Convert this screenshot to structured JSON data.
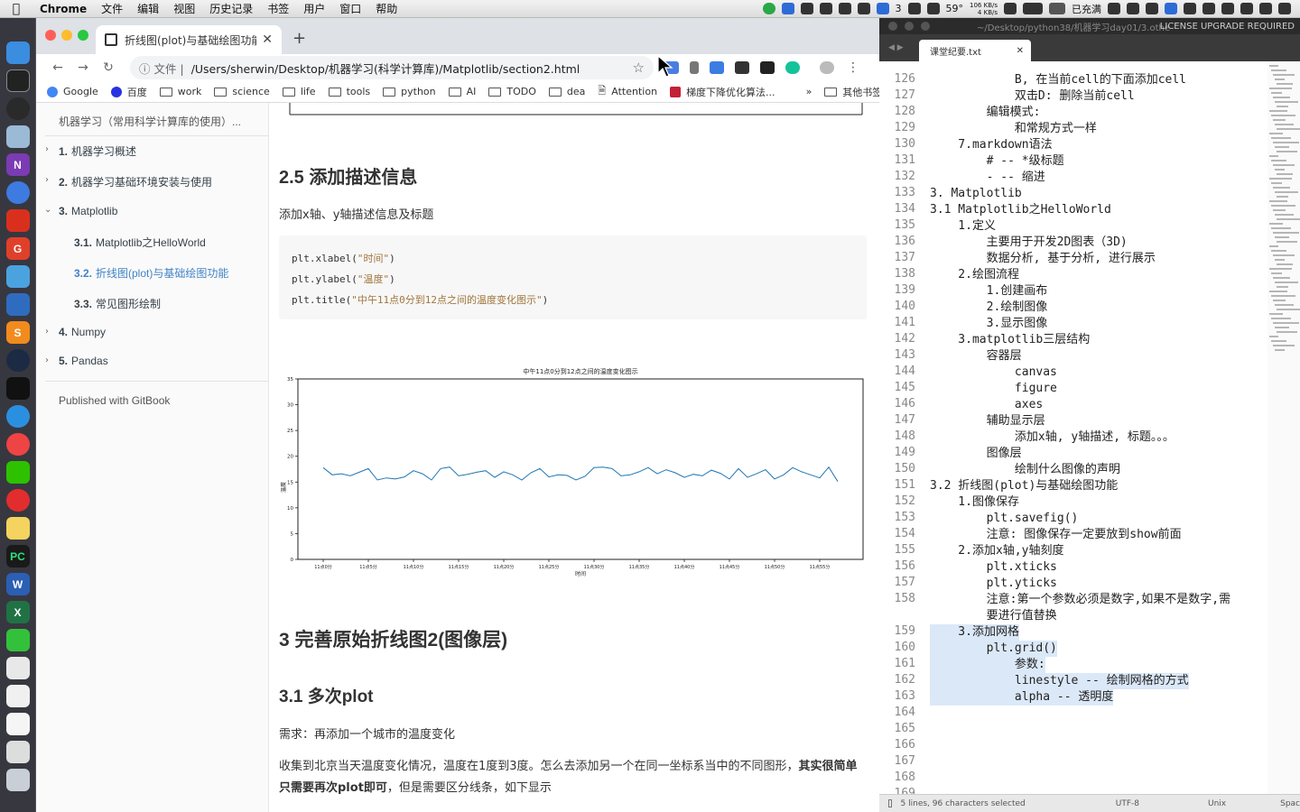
{
  "menubar": {
    "app": "Chrome",
    "items": [
      "文件",
      "编辑",
      "视图",
      "历史记录",
      "书签",
      "用户",
      "窗口",
      "帮助"
    ],
    "tray_count": "3",
    "temperature": "59°",
    "net_up": "106 KB/s",
    "net_down": "4 KB/s",
    "battery": "已充满"
  },
  "chrome": {
    "tab_title": "折线图(plot)与基础绘图功能 | 机",
    "address_info": "文件",
    "url": "/Users/sherwin/Desktop/机器学习(科学计算库)/Matplotlib/section2.html",
    "bookmarks": [
      "Google",
      "百度",
      "work",
      "science",
      "life",
      "tools",
      "python",
      "AI",
      "TODO",
      "dea",
      "Attention",
      "梯度下降优化算法..."
    ],
    "bookmarks_more": "»",
    "other_bookmarks": "其他书签"
  },
  "toc": {
    "title": "机器学习（常用科学计算库的使用）...",
    "items": [
      {
        "num": "1.",
        "label": "机器学习概述"
      },
      {
        "num": "2.",
        "label": "机器学习基础环境安装与使用"
      },
      {
        "num": "3.",
        "label": "Matplotlib"
      },
      {
        "num": "3.1.",
        "label": "Matplotlib之HelloWorld"
      },
      {
        "num": "3.2.",
        "label": "折线图(plot)与基础绘图功能"
      },
      {
        "num": "3.3.",
        "label": "常见图形绘制"
      },
      {
        "num": "4.",
        "label": "Numpy"
      },
      {
        "num": "5.",
        "label": "Pandas"
      }
    ],
    "published": "Published with GitBook"
  },
  "content": {
    "h_25": "2.5 添加描述信息",
    "p_25": "添加x轴、y轴描述信息及标题",
    "code": [
      {
        "pre": "plt.xlabel(",
        "str": "\"时间\"",
        "post": ")"
      },
      {
        "pre": "plt.ylabel(",
        "str": "\"温度\"",
        "post": ")"
      },
      {
        "pre": "plt.title(",
        "str": "\"中午11点0分到12点之间的温度变化图示\"",
        "post": ")"
      }
    ],
    "h_3": "3 完善原始折线图2(图像层)",
    "h_31": "3.1 多次plot",
    "p_need": "需求：再添加一个城市的温度变化",
    "p_desc_1": "收集到北京当天温度变化情况，温度在1度到3度。怎么去添加另一个在同一坐标系当中的不同图形，",
    "p_desc_bold": "其实很简单只需要再次plot即可",
    "p_desc_2": "，但是需要区分线条，如下显示"
  },
  "chart_data": {
    "type": "line",
    "title": "中午11点0分到12点之间的温度变化图示",
    "xlabel": "时间",
    "ylabel": "温度",
    "ylim": [
      0,
      35
    ],
    "yticks": [
      0,
      5,
      10,
      15,
      20,
      25,
      30,
      35
    ],
    "xticks": [
      "11点0分",
      "11点5分",
      "11点10分",
      "11点15分",
      "11点20分",
      "11点25分",
      "11点30分",
      "11点35分",
      "11点40分",
      "11点45分",
      "11点50分",
      "11点55分"
    ],
    "color": "#1f77b4",
    "series": [
      {
        "values": [
          17.8,
          16.4,
          16.6,
          16.2,
          16.9,
          17.6,
          15.4,
          15.8,
          15.6,
          16.0,
          17.2,
          16.6,
          15.4,
          17.6,
          17.9,
          16.2,
          16.5,
          16.9,
          17.2,
          15.9,
          17.0,
          16.4,
          15.4,
          16.8,
          17.6,
          16.0,
          16.4,
          16.3,
          15.4,
          16.1,
          17.8,
          17.9,
          17.6,
          16.2,
          16.4,
          17.0,
          17.8,
          16.6,
          17.4,
          16.8,
          15.9,
          16.5,
          16.2,
          17.3,
          16.7,
          15.6,
          17.6,
          15.9,
          16.6,
          17.4,
          15.6,
          16.4,
          17.8,
          17.0,
          16.4,
          15.8,
          17.9,
          15.1
        ]
      }
    ]
  },
  "sublime": {
    "title_path": "~/Desktop/python38/机器学习day01/3.othe",
    "license": "LICENSE UPGRADE REQUIRED",
    "tab": "课堂纪要.txt",
    "status_sel": "5 lines, 96 characters selected",
    "status_enc": "UTF-8",
    "status_eol": "Unix",
    "status_ind": "Spac",
    "lines": [
      {
        "n": "126",
        "t": "            B, 在当前cell的下面添加cell"
      },
      {
        "n": "127",
        "t": "            双击D: 删除当前cell"
      },
      {
        "n": "128",
        "t": "        编辑模式:"
      },
      {
        "n": "129",
        "t": "            和常规方式一样"
      },
      {
        "n": "130",
        "t": "    7.markdown语法"
      },
      {
        "n": "131",
        "t": "        # -- *级标题"
      },
      {
        "n": "132",
        "t": "        - -- 缩进"
      },
      {
        "n": "133",
        "t": "3. Matplotlib"
      },
      {
        "n": "134",
        "t": "3.1 Matplotlib之HelloWorld"
      },
      {
        "n": "135",
        "t": "    1.定义"
      },
      {
        "n": "136",
        "t": "        主要用于开发2D图表（3D)"
      },
      {
        "n": "137",
        "t": "        数据分析, 基于分析, 进行展示"
      },
      {
        "n": "138",
        "t": "    2.绘图流程"
      },
      {
        "n": "139",
        "t": "        1.创建画布"
      },
      {
        "n": "140",
        "t": "        2.绘制图像"
      },
      {
        "n": "141",
        "t": "        3.显示图像"
      },
      {
        "n": "142",
        "t": "    3.matplotlib三层结构"
      },
      {
        "n": "143",
        "t": "        容器层"
      },
      {
        "n": "144",
        "t": "            canvas"
      },
      {
        "n": "145",
        "t": "            figure"
      },
      {
        "n": "146",
        "t": "            axes"
      },
      {
        "n": "147",
        "t": "        辅助显示层"
      },
      {
        "n": "148",
        "t": "            添加x轴, y轴描述, 标题。。。"
      },
      {
        "n": "149",
        "t": "        图像层"
      },
      {
        "n": "150",
        "t": "            绘制什么图像的声明"
      },
      {
        "n": "151",
        "t": "3.2 折线图(plot)与基础绘图功能"
      },
      {
        "n": "152",
        "t": "    1.图像保存"
      },
      {
        "n": "153",
        "t": "        plt.savefig()"
      },
      {
        "n": "154",
        "t": "        注意: 图像保存一定要放到show前面"
      },
      {
        "n": "155",
        "t": "    2.添加x轴,y轴刻度"
      },
      {
        "n": "156",
        "t": "        plt.xticks"
      },
      {
        "n": "157",
        "t": "        plt.yticks"
      },
      {
        "n": "158",
        "t": "        注意:第一个参数必须是数字,如果不是数字,需"
      },
      {
        "n": "",
        "t": "        要进行值替换"
      },
      {
        "n": "159",
        "t": "    3.添加网格"
      },
      {
        "n": "160",
        "t": "        plt.grid()"
      },
      {
        "n": "161",
        "t": "            参数:"
      },
      {
        "n": "162",
        "t": "            linestyle -- 绘制网格的方式"
      },
      {
        "n": "163",
        "t": "            alpha -- 透明度"
      },
      {
        "n": "164",
        "t": ""
      },
      {
        "n": "165",
        "t": ""
      },
      {
        "n": "166",
        "t": ""
      },
      {
        "n": "167",
        "t": ""
      },
      {
        "n": "168",
        "t": ""
      },
      {
        "n": "169",
        "t": ""
      }
    ]
  }
}
